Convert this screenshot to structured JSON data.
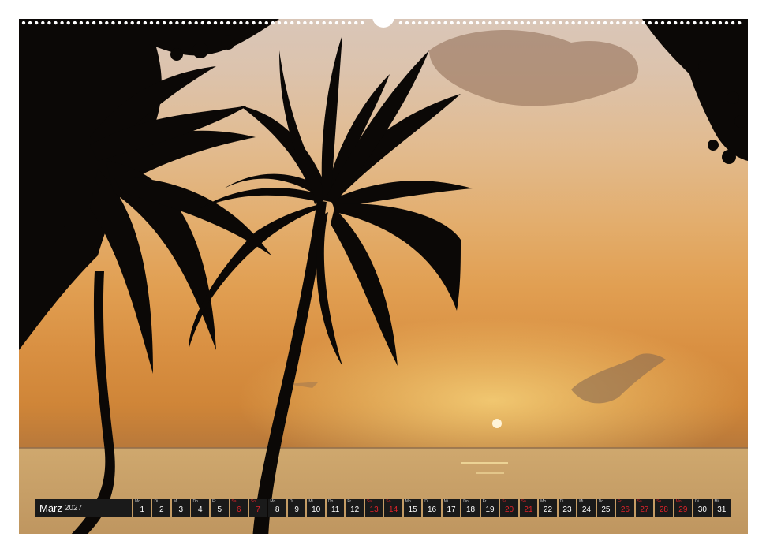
{
  "calendar": {
    "month": "März",
    "year": "2027",
    "weekend_color": "#e0232a",
    "days": [
      {
        "wd": "Mo",
        "n": "1",
        "weekend": false
      },
      {
        "wd": "Di",
        "n": "2",
        "weekend": false
      },
      {
        "wd": "Mi",
        "n": "3",
        "weekend": false
      },
      {
        "wd": "Do",
        "n": "4",
        "weekend": false
      },
      {
        "wd": "Fr",
        "n": "5",
        "weekend": false
      },
      {
        "wd": "Sa",
        "n": "6",
        "weekend": true
      },
      {
        "wd": "So",
        "n": "7",
        "weekend": true
      },
      {
        "wd": "Mo",
        "n": "8",
        "weekend": false
      },
      {
        "wd": "Di",
        "n": "9",
        "weekend": false
      },
      {
        "wd": "Mi",
        "n": "10",
        "weekend": false
      },
      {
        "wd": "Do",
        "n": "11",
        "weekend": false
      },
      {
        "wd": "Fr",
        "n": "12",
        "weekend": false
      },
      {
        "wd": "Sa",
        "n": "13",
        "weekend": true
      },
      {
        "wd": "So",
        "n": "14",
        "weekend": true
      },
      {
        "wd": "Mo",
        "n": "15",
        "weekend": false
      },
      {
        "wd": "Di",
        "n": "16",
        "weekend": false
      },
      {
        "wd": "Mi",
        "n": "17",
        "weekend": false
      },
      {
        "wd": "Do",
        "n": "18",
        "weekend": false
      },
      {
        "wd": "Fr",
        "n": "19",
        "weekend": false
      },
      {
        "wd": "Sa",
        "n": "20",
        "weekend": true
      },
      {
        "wd": "So",
        "n": "21",
        "weekend": true
      },
      {
        "wd": "Mo",
        "n": "22",
        "weekend": false
      },
      {
        "wd": "Di",
        "n": "23",
        "weekend": false
      },
      {
        "wd": "Mi",
        "n": "24",
        "weekend": false
      },
      {
        "wd": "Do",
        "n": "25",
        "weekend": false
      },
      {
        "wd": "Fr",
        "n": "26",
        "weekend": true
      },
      {
        "wd": "Sa",
        "n": "27",
        "weekend": true
      },
      {
        "wd": "So",
        "n": "28",
        "weekend": true
      },
      {
        "wd": "Mo",
        "n": "29",
        "weekend": true
      },
      {
        "wd": "Di",
        "n": "30",
        "weekend": false
      },
      {
        "wd": "Mi",
        "n": "31",
        "weekend": false
      }
    ]
  }
}
